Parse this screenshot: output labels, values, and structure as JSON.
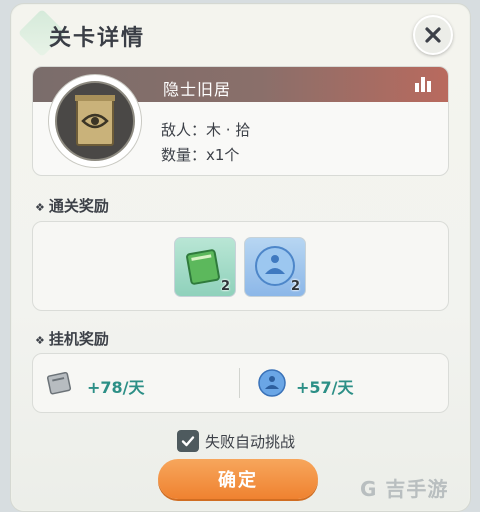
{
  "dialog": {
    "title": "关卡详情"
  },
  "stage": {
    "name": "隐士旧居",
    "enemy_line": "敌人：木 · 拾",
    "count_line": "数量：x1个"
  },
  "clear_rewards": {
    "label": "通关奖励",
    "items": [
      {
        "icon": "green-book-icon",
        "count": "2"
      },
      {
        "icon": "blue-spirit-orb-icon",
        "count": "2"
      }
    ]
  },
  "idle_rewards": {
    "label": "挂机奖励",
    "items": [
      {
        "icon": "silver-scroll-icon",
        "value": "+78/天"
      },
      {
        "icon": "blue-orb-icon",
        "value": "+57/天"
      }
    ]
  },
  "auto_challenge": {
    "label": "失败自动挑战",
    "checked": true
  },
  "confirm": {
    "label": "确定"
  },
  "watermark": {
    "text": "G 吉手游"
  },
  "colors": {
    "header_gradient_start": "#7a6d6b",
    "header_gradient_end": "#b96a5e",
    "confirm_button": "#ef8230",
    "value_text": "#2c8f86"
  }
}
